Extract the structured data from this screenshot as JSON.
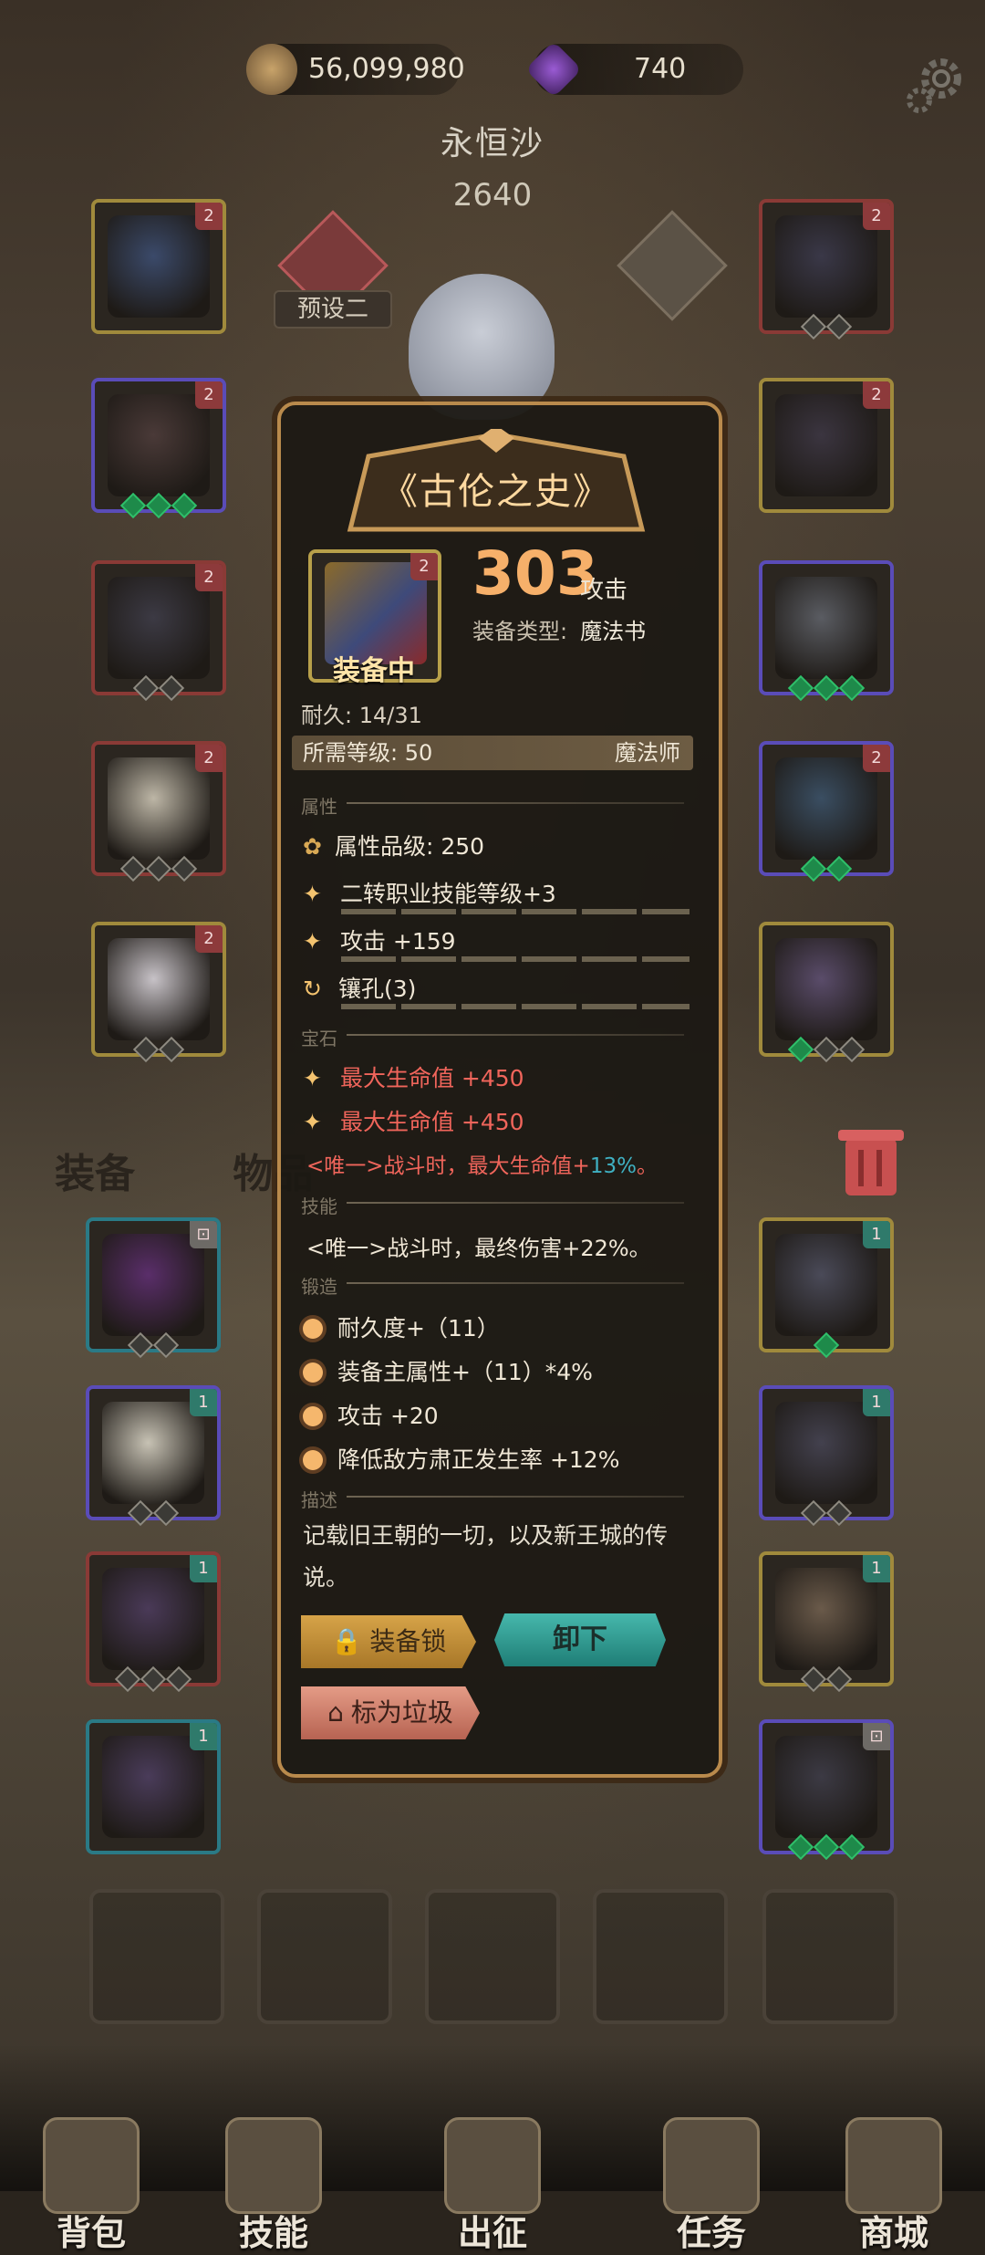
{
  "currency": {
    "gold": "56,099,980",
    "gems": "740"
  },
  "character": {
    "name": "永恒沙",
    "power": "2640",
    "preset": "预设二"
  },
  "tabs": {
    "equip": "装备",
    "items": "物品"
  },
  "nav": [
    {
      "label": "背包"
    },
    {
      "label": "技能"
    },
    {
      "label": "出征"
    },
    {
      "label": "任务"
    },
    {
      "label": "商城"
    }
  ],
  "slots": {
    "left": [
      {
        "frame": "#a08a3c",
        "lock": "2",
        "lock_color": "red",
        "item": "#3b4a6a",
        "dots": []
      },
      {
        "frame": "#5a4cb8",
        "lock": "2",
        "lock_color": "red",
        "item": "#4a3a38",
        "dots": [
          "g",
          "g",
          "g"
        ]
      },
      {
        "frame": "#8a3a36",
        "lock": "2",
        "lock_color": "red",
        "item": "#3c3a44",
        "dots": [
          "",
          ""
        ]
      },
      {
        "frame": "#8a3a36",
        "lock": "2",
        "lock_color": "red",
        "item": "#bdb6a6",
        "dots": [
          "",
          "",
          ""
        ]
      },
      {
        "frame": "#a08a3c",
        "lock": "2",
        "lock_color": "red",
        "item": "#c7c2c7",
        "dots": [
          "",
          ""
        ]
      }
    ],
    "right": [
      {
        "frame": "#8a3a36",
        "lock": "2",
        "lock_color": "red",
        "item": "#3a3848",
        "dots": [
          "",
          ""
        ]
      },
      {
        "frame": "#a08a3c",
        "lock": "2",
        "lock_color": "red",
        "item": "#3b3540",
        "dots": []
      },
      {
        "frame": "#5a4cb8",
        "lock": "",
        "lock_color": "red",
        "item": "#5a5c62",
        "dots": [
          "g",
          "g",
          "g"
        ]
      },
      {
        "frame": "#5a4cb8",
        "lock": "2",
        "lock_color": "red",
        "item": "#3a4e62",
        "dots": [
          "g",
          "g"
        ]
      },
      {
        "frame": "#a08a3c",
        "lock": "",
        "lock_color": "red",
        "item": "#5a4c6a",
        "dots": [
          "g",
          "",
          ""
        ]
      }
    ]
  },
  "bag": [
    {
      "frame": "#2a7a86",
      "lock": "",
      "lock_color": "grey",
      "item": "#5a2e6a",
      "dots": [
        "",
        ""
      ]
    },
    {
      "frame": "#a08a3c",
      "lock": "1",
      "lock_color": "teal",
      "item": "#4a4a58",
      "dots": [
        "g"
      ]
    },
    {
      "frame": "#5a4cb8",
      "lock": "1",
      "lock_color": "teal",
      "item": "#c7c2b4",
      "dots": [
        "",
        ""
      ]
    },
    {
      "frame": "#5a4cb8",
      "lock": "1",
      "lock_color": "teal",
      "item": "#43414e",
      "dots": [
        "",
        ""
      ]
    },
    {
      "frame": "#8a3a36",
      "lock": "1",
      "lock_color": "teal",
      "item": "#4a3a58",
      "dots": [
        "",
        "",
        ""
      ]
    },
    {
      "frame": "#a08a3c",
      "lock": "1",
      "lock_color": "teal",
      "item": "#6a5a4a",
      "dots": [
        "",
        ""
      ]
    },
    {
      "frame": "#2a7a86",
      "lock": "1",
      "lock_color": "teal",
      "item": "#4a3c5a",
      "dots": []
    },
    {
      "frame": "#5a4cb8",
      "lock": "",
      "lock_color": "grey",
      "item": "#3c3a44",
      "dots": [
        "g",
        "g",
        "g"
      ]
    }
  ],
  "item": {
    "title": "《古伦之史》",
    "lock_tier": "2",
    "equipped_label": "装备中",
    "power": "303",
    "power_unit": "攻击",
    "type_label": "装备类型:",
    "type_value": "魔法书",
    "durability": "耐久:  14/31",
    "req_level": "所需等级:  50",
    "req_class": "魔法师",
    "sections": {
      "attr": "属性",
      "gem": "宝石",
      "skill": "技能",
      "forge": "锻造",
      "desc": "描述"
    },
    "attr_quality": "属性品级:  250",
    "attrs": [
      "二转职业技能等级+3",
      "攻击 +159",
      "镶孔(3)"
    ],
    "gems": [
      "最大生命值 +450",
      "最大生命值 +450"
    ],
    "gem_unique_prefix": "<唯一>战斗时，最大生命值+",
    "gem_unique_value": "13%",
    "gem_unique_suffix": "。",
    "skill_text": "<唯一>战斗时，最终伤害+22%。",
    "forge": [
      "耐久度+（11）",
      "装备主属性+（11）*4%",
      "攻击 +20",
      "降低敌方肃正发生率 +12%"
    ],
    "description": "记载旧王朝的一切，以及新王城的传说。",
    "btn_lock": "装备锁",
    "btn_unequip": "卸下",
    "btn_trash": "标为垃圾"
  }
}
